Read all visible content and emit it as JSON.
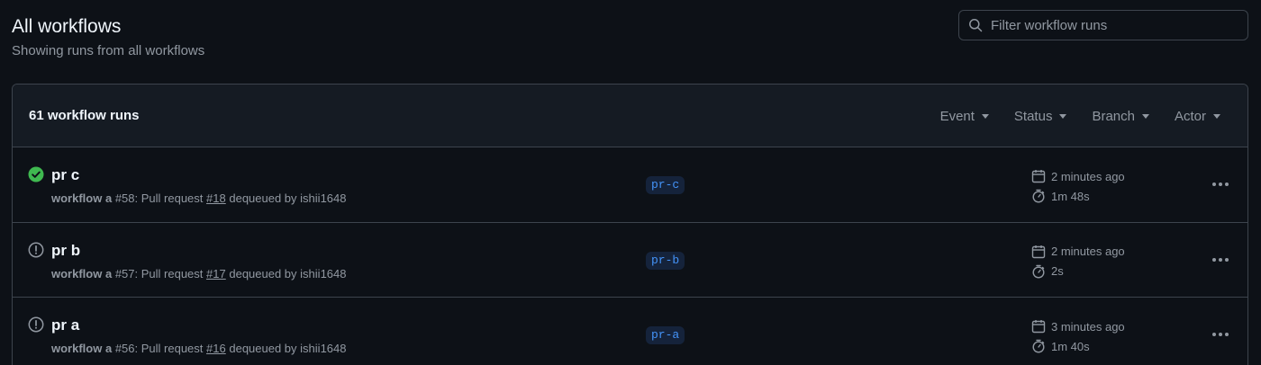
{
  "header": {
    "title": "All workflows",
    "subtitle": "Showing runs from all workflows"
  },
  "search": {
    "placeholder": "Filter workflow runs",
    "icon": "search-icon"
  },
  "runs_box": {
    "count_label": "61 workflow runs",
    "filters": [
      "Event",
      "Status",
      "Branch",
      "Actor"
    ]
  },
  "runs": [
    {
      "status": "success",
      "status_icon": "check-circle-icon",
      "title": "pr c",
      "workflow": "workflow a",
      "run_number": "#58",
      "event_text": "Pull request",
      "pr_number": "#18",
      "action_text": "dequeued by",
      "actor": "ishii1648",
      "branch": "pr-c",
      "time_ago": "2 minutes ago",
      "duration": "1m 48s"
    },
    {
      "status": "dequeued",
      "status_icon": "alert-circle-icon",
      "title": "pr b",
      "workflow": "workflow a",
      "run_number": "#57",
      "event_text": "Pull request",
      "pr_number": "#17",
      "action_text": "dequeued by",
      "actor": "ishii1648",
      "branch": "pr-b",
      "time_ago": "2 minutes ago",
      "duration": "2s"
    },
    {
      "status": "dequeued",
      "status_icon": "alert-circle-icon",
      "title": "pr a",
      "workflow": "workflow a",
      "run_number": "#56",
      "event_text": "Pull request",
      "pr_number": "#16",
      "action_text": "dequeued by",
      "actor": "ishii1648",
      "branch": "pr-a",
      "time_ago": "3 minutes ago",
      "duration": "1m 40s"
    }
  ],
  "colors": {
    "background": "#0d1117",
    "header_bg": "#151b23",
    "border": "#3d444d",
    "success": "#3fb950",
    "muted": "#9198a1",
    "branch_fg": "#4493f8",
    "branch_bg": "#15233b"
  }
}
